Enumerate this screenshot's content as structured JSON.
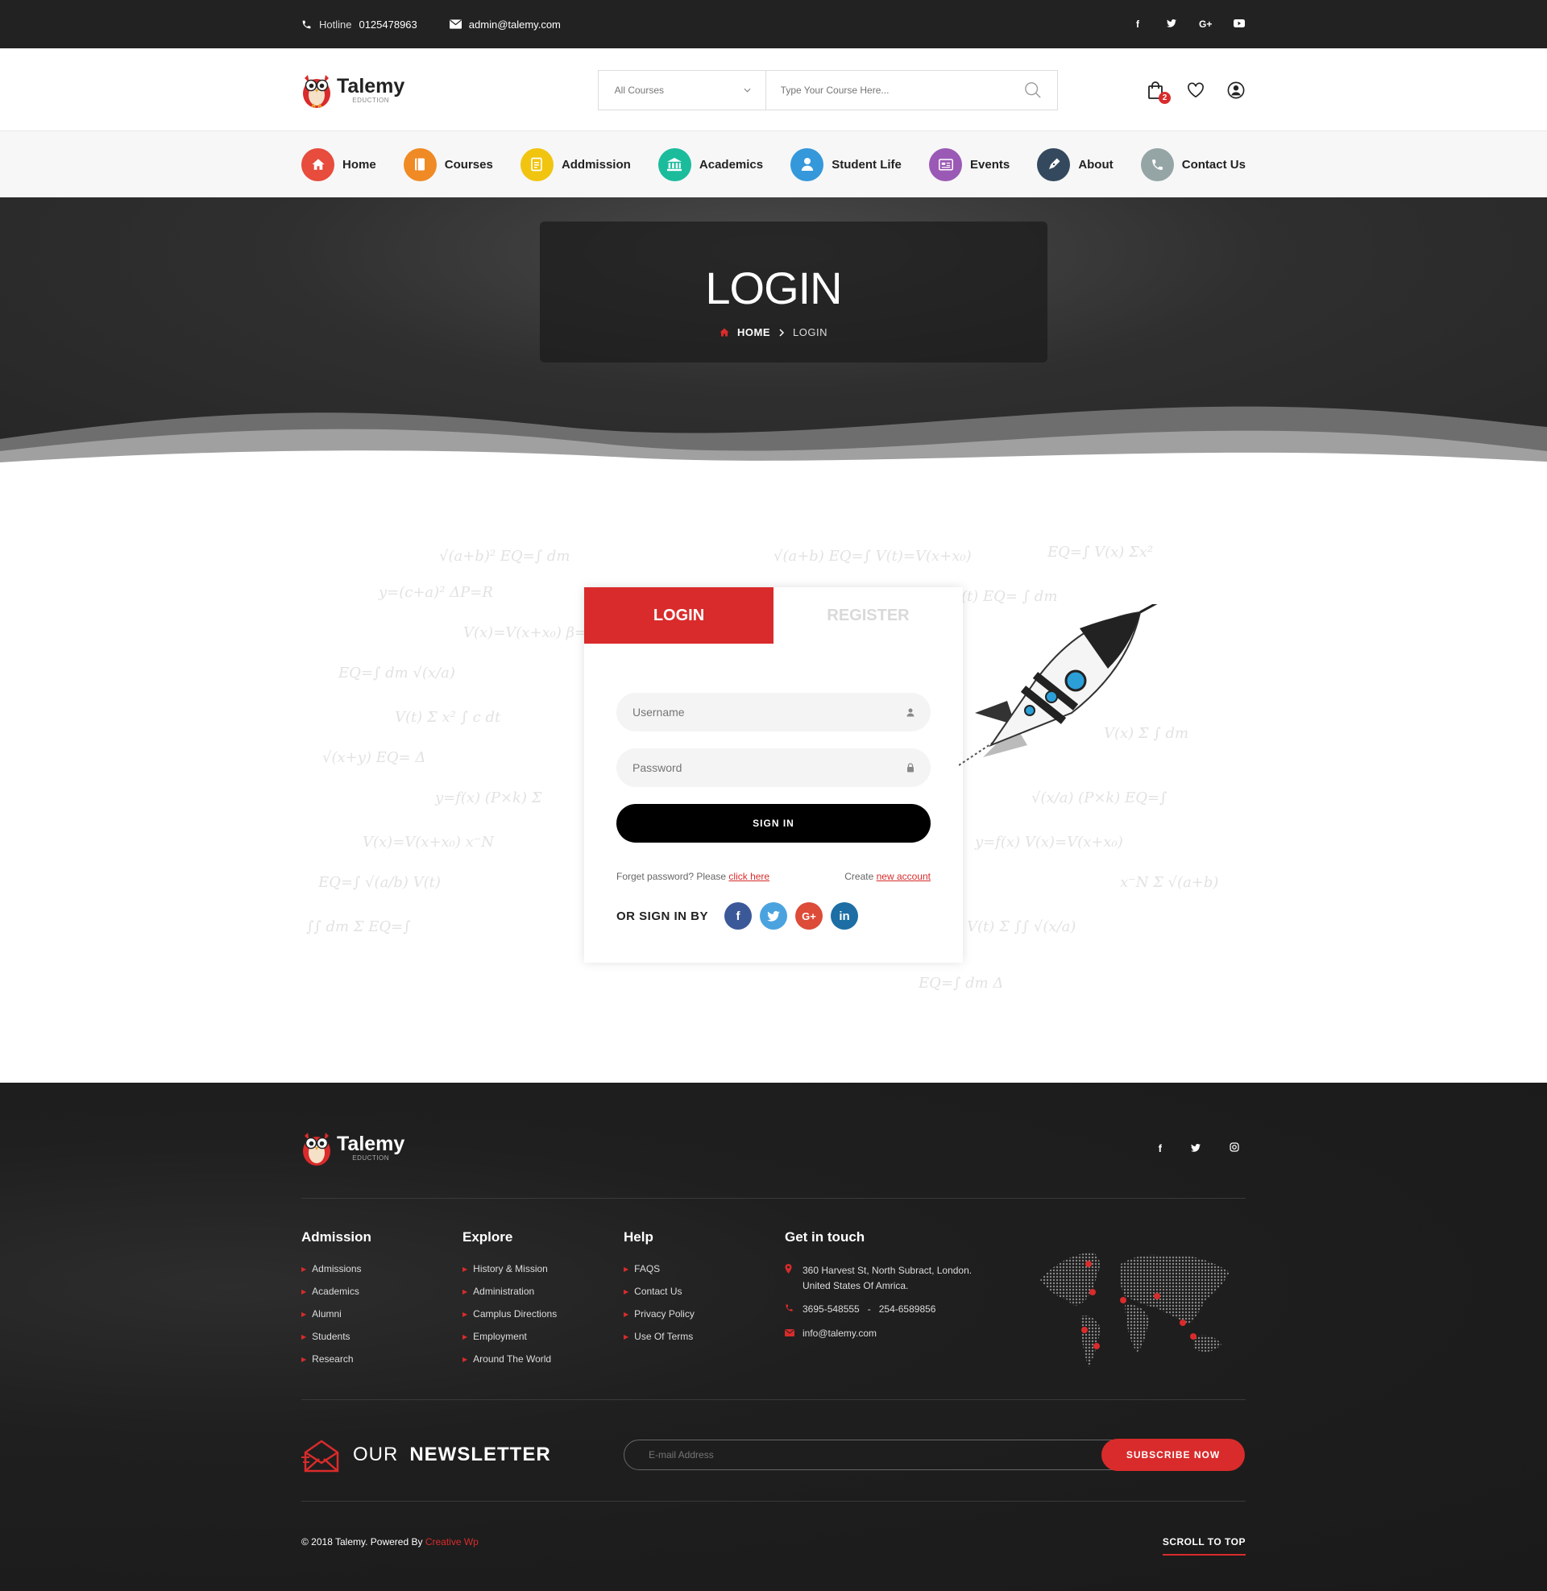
{
  "topbar": {
    "hotline_label": "Hotline",
    "hotline_number": "0125478963",
    "email": "admin@talemy.com",
    "social": [
      "f",
      "t",
      "G+",
      "yt"
    ]
  },
  "brand": {
    "name": "Talemy",
    "tagline": "EDUCTION"
  },
  "search": {
    "category": "All Courses",
    "placeholder": "Type Your Course Here..."
  },
  "header": {
    "cart_count": "2"
  },
  "nav": [
    {
      "label": "Home",
      "color": "#e74c3c",
      "icon": "home-icon"
    },
    {
      "label": "Courses",
      "color": "#f08a24",
      "icon": "book-icon"
    },
    {
      "label": "Addmission",
      "color": "#f1c40f",
      "icon": "document-icon"
    },
    {
      "label": "Academics",
      "color": "#1abc9c",
      "icon": "bank-icon"
    },
    {
      "label": "Student Life",
      "color": "#3498db",
      "icon": "user-icon"
    },
    {
      "label": "Events",
      "color": "#9b59b6",
      "icon": "calendar-icon"
    },
    {
      "label": "About",
      "color": "#34495e",
      "icon": "pen-icon"
    },
    {
      "label": "Contact Us",
      "color": "#95a5a6",
      "icon": "phone-icon"
    }
  ],
  "hero": {
    "title": "LOGIN",
    "breadcrumb_home": "HOME",
    "breadcrumb_current": "LOGIN"
  },
  "login": {
    "tab_login": "LOGIN",
    "tab_register": "REGISTER",
    "username_placeholder": "Username",
    "password_placeholder": "Password",
    "signin_label": "SIGN IN",
    "forgot_text": "Forget password? Please",
    "forgot_link": "click here",
    "create_text": "Create",
    "create_link": "new account",
    "social_label": "OR SIGN IN BY",
    "social": [
      {
        "name": "facebook",
        "glyph": "f",
        "color": "#3b5998"
      },
      {
        "name": "twitter",
        "glyph": "t",
        "color": "#4aa3df"
      },
      {
        "name": "google-plus",
        "glyph": "G+",
        "color": "#dd4b39"
      },
      {
        "name": "linkedin",
        "glyph": "in",
        "color": "#1c6ea4"
      }
    ]
  },
  "footer": {
    "social": [
      "f",
      "t",
      "ig"
    ],
    "columns": [
      {
        "title": "Admission",
        "items": [
          "Admissions",
          "Academics",
          "Alumni",
          "Students",
          "Research"
        ]
      },
      {
        "title": "Explore",
        "items": [
          "History & Mission",
          "Administration",
          "Camplus Directions",
          "Employment",
          "Around The World"
        ]
      },
      {
        "title": "Help",
        "items": [
          "FAQS",
          "Contact Us",
          "Privacy Policy",
          "Use Of Terms"
        ]
      }
    ],
    "contact": {
      "title": "Get in touch",
      "address_line1": "360 Harvest St, North Subract, London.",
      "address_line2": "United States Of Amrica.",
      "phone": "3695-548555   -   254-6589856",
      "email": "info@talemy.com"
    },
    "newsletter": {
      "title_light": "OUR",
      "title_bold": "NEWSLETTER",
      "placeholder": "E-mail Address",
      "button": "SUBSCRIBE NOW"
    },
    "copyright": "© 2018 Talemy.  Powered By",
    "powered_brand": "Creative Wp",
    "scroll_top": "SCROLL TO TOP"
  }
}
